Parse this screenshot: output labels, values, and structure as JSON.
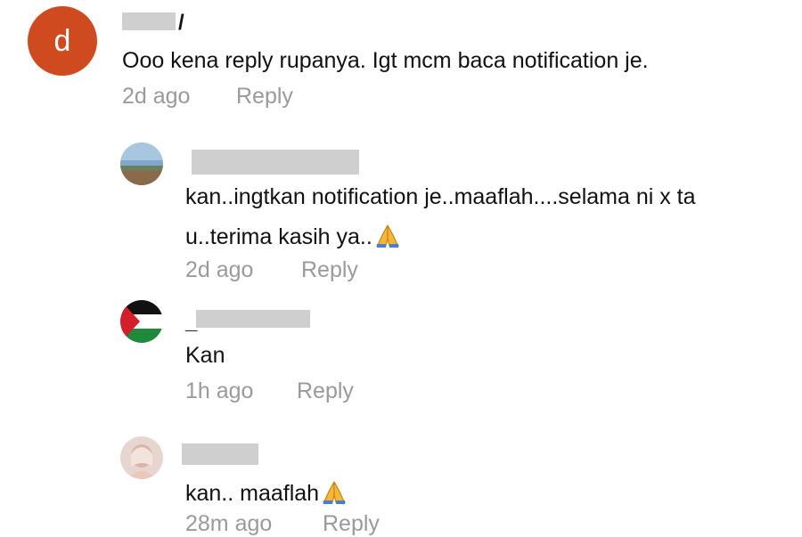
{
  "comments": [
    {
      "avatar_letter": "d",
      "username_tail": "/",
      "text": "Ooo kena reply rupanya. Igt mcm baca notification je.",
      "time": "2d ago",
      "reply_label": "Reply"
    },
    {
      "username_tail": "",
      "text_line1": "kan..ingtkan notification je..maaflah....selama ni x ta",
      "text_line2": "u..terima kasih ya..",
      "emoji": "folded-hands",
      "time": "2d ago",
      "reply_label": "Reply"
    },
    {
      "username_head": "_",
      "text": "Kan",
      "time": "1h ago",
      "reply_label": "Reply"
    },
    {
      "text": "kan.. maaflah",
      "emoji": "folded-hands",
      "time": "28m ago",
      "reply_label": "Reply"
    }
  ],
  "colors": {
    "letter_avatar_bg": "#cf4a1f",
    "meta_text": "#9a9a9a",
    "redaction": "#cfcfcf"
  }
}
